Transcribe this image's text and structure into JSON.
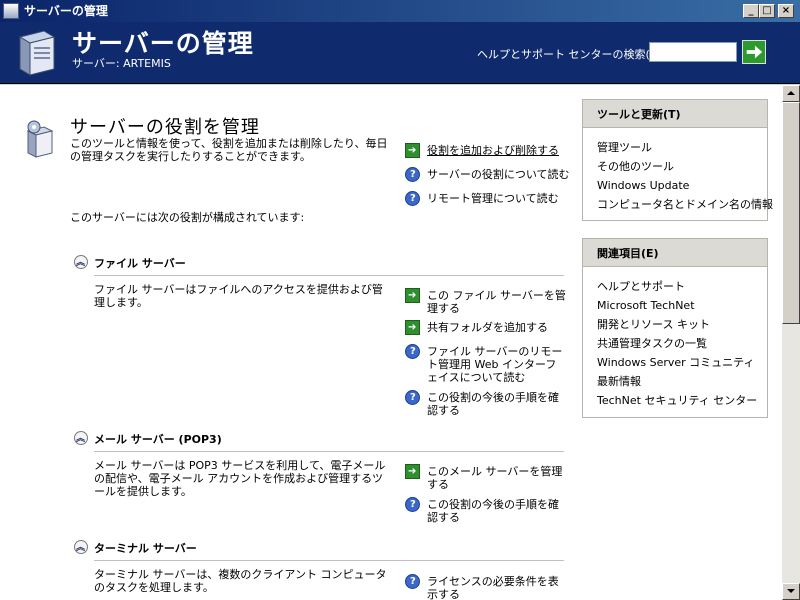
{
  "window": {
    "title": "サーバーの管理",
    "controls": {
      "minimize": "_",
      "maximize": "□",
      "close": "×"
    }
  },
  "header": {
    "title": "サーバーの管理",
    "server_label": "サーバー: ARTEMIS",
    "search_label": "ヘルプとサポート センターの検索(S)",
    "search_value": "",
    "go_icon": "green-arrow-icon"
  },
  "main": {
    "title": "サーバーの役割を管理",
    "description": "このツールと情報を使って、役割を追加または削除したり、毎日の管理タスクを実行したりすることができます。",
    "top_actions": [
      {
        "label": "役割を追加および削除する",
        "icon": "green-arrow-icon"
      },
      {
        "label": "サーバーの役割について読む",
        "icon": "help-icon"
      },
      {
        "label": "リモート管理について読む",
        "icon": "help-icon"
      }
    ],
    "roles_intro": "このサーバーには次の役割が構成されています:",
    "sections": [
      {
        "title": "ファイル サーバー",
        "description": "ファイル サーバーはファイルへのアクセスを提供および管理します。",
        "actions": [
          {
            "label": "この ファイル サーバーを管理する",
            "icon": "green-arrow-icon"
          },
          {
            "label": "共有フォルダを追加する",
            "icon": "green-arrow-icon"
          },
          {
            "label": "ファイル サーバーのリモート管理用 Web インターフェイスについて読む",
            "icon": "help-icon"
          },
          {
            "label": "この役割の今後の手順を確認する",
            "icon": "help-icon"
          }
        ]
      },
      {
        "title": "メール サーバー (POP3)",
        "description": "メール サーバーは POP3 サービスを利用して、電子メールの配信や、電子メール アカウントを作成および管理するツールを提供します。",
        "actions": [
          {
            "label": "このメール サーバーを管理する",
            "icon": "green-arrow-icon"
          },
          {
            "label": "この役割の今後の手順を確認する",
            "icon": "help-icon"
          }
        ]
      },
      {
        "title": "ターミナル サーバー",
        "description": "ターミナル サーバーは、複数のクライアント コンピュータのタスクを処理します。",
        "actions": [
          {
            "label": "ライセンスの必要条件を表示する",
            "icon": "help-icon"
          }
        ]
      }
    ]
  },
  "panes": {
    "tools": {
      "title": "ツールと更新(T)",
      "items": [
        "管理ツール",
        "その他のツール",
        "Windows Update",
        "コンピュータ名とドメイン名の情報"
      ]
    },
    "related": {
      "title": "関連項目(E)",
      "items": [
        "ヘルプとサポート",
        "Microsoft TechNet",
        "開発とリソース キット",
        "共通管理タスクの一覧",
        "Windows Server コミュニティ",
        "最新情報",
        "TechNet セキュリティ センター"
      ]
    }
  }
}
